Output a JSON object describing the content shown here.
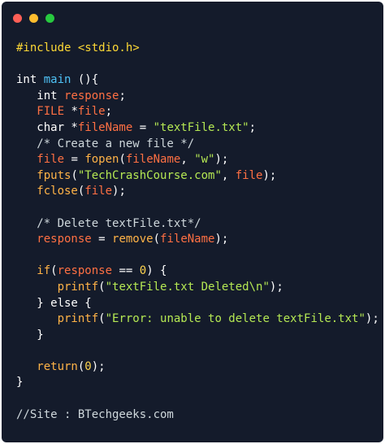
{
  "window": {
    "controls": [
      {
        "name": "close",
        "color": "#ff5f56"
      },
      {
        "name": "minimize",
        "color": "#ffbd2e"
      },
      {
        "name": "maximize",
        "color": "#27c93f"
      }
    ]
  },
  "colors": {
    "background": "#141b2b",
    "plain": "#ffffff",
    "preprocessor": "#fdd835",
    "keyword": "#ffffff",
    "variable": "#ff7043",
    "string": "#b5e853",
    "comment": "#cfd8dc",
    "function": "#ffb347",
    "number": "#ffd54f",
    "identifier": "#4fc3f7"
  },
  "code_lines": [
    [
      {
        "t": "#include <stdio.h>",
        "c": "preprocessor"
      }
    ],
    [],
    [
      {
        "t": "int ",
        "c": "keyword"
      },
      {
        "t": "main",
        "c": "identifier"
      },
      {
        "t": " (){",
        "c": "plain"
      }
    ],
    [
      {
        "t": "   int ",
        "c": "keyword"
      },
      {
        "t": "response",
        "c": "variable"
      },
      {
        "t": ";",
        "c": "plain"
      }
    ],
    [
      {
        "t": "   FILE ",
        "c": "variable"
      },
      {
        "t": "*",
        "c": "plain"
      },
      {
        "t": "file",
        "c": "variable"
      },
      {
        "t": ";",
        "c": "plain"
      }
    ],
    [
      {
        "t": "   char *",
        "c": "keyword"
      },
      {
        "t": "fileName",
        "c": "variable"
      },
      {
        "t": " = ",
        "c": "plain"
      },
      {
        "t": "\"textFile.txt\"",
        "c": "string"
      },
      {
        "t": ";",
        "c": "plain"
      }
    ],
    [
      {
        "t": "   /* Create a new file */",
        "c": "comment"
      }
    ],
    [
      {
        "t": "   file",
        "c": "variable"
      },
      {
        "t": " = ",
        "c": "plain"
      },
      {
        "t": "fopen",
        "c": "function"
      },
      {
        "t": "(",
        "c": "plain"
      },
      {
        "t": "fileName",
        "c": "variable"
      },
      {
        "t": ", ",
        "c": "plain"
      },
      {
        "t": "\"w\"",
        "c": "string"
      },
      {
        "t": ");",
        "c": "plain"
      }
    ],
    [
      {
        "t": "   fputs",
        "c": "function"
      },
      {
        "t": "(",
        "c": "plain"
      },
      {
        "t": "\"TechCrashCourse.com\"",
        "c": "string"
      },
      {
        "t": ", ",
        "c": "plain"
      },
      {
        "t": "file",
        "c": "variable"
      },
      {
        "t": ");",
        "c": "plain"
      }
    ],
    [
      {
        "t": "   fclose",
        "c": "function"
      },
      {
        "t": "(",
        "c": "plain"
      },
      {
        "t": "file",
        "c": "variable"
      },
      {
        "t": ");",
        "c": "plain"
      }
    ],
    [],
    [
      {
        "t": "   /* Delete textFile.txt*/",
        "c": "comment"
      }
    ],
    [
      {
        "t": "   response",
        "c": "variable"
      },
      {
        "t": " = ",
        "c": "plain"
      },
      {
        "t": "remove",
        "c": "function"
      },
      {
        "t": "(",
        "c": "plain"
      },
      {
        "t": "fileName",
        "c": "variable"
      },
      {
        "t": ");",
        "c": "plain"
      }
    ],
    [],
    [
      {
        "t": "   if",
        "c": "function"
      },
      {
        "t": "(",
        "c": "plain"
      },
      {
        "t": "response",
        "c": "variable"
      },
      {
        "t": " == ",
        "c": "plain"
      },
      {
        "t": "0",
        "c": "number"
      },
      {
        "t": ") {",
        "c": "plain"
      }
    ],
    [
      {
        "t": "      printf",
        "c": "function"
      },
      {
        "t": "(",
        "c": "plain"
      },
      {
        "t": "\"textFile.txt Deleted\\n\"",
        "c": "string"
      },
      {
        "t": ");",
        "c": "plain"
      }
    ],
    [
      {
        "t": "   } else {",
        "c": "plain"
      }
    ],
    [
      {
        "t": "      printf",
        "c": "function"
      },
      {
        "t": "(",
        "c": "plain"
      },
      {
        "t": "\"Error: unable to delete textFile.txt\"",
        "c": "string"
      },
      {
        "t": ");",
        "c": "plain"
      }
    ],
    [
      {
        "t": "   }",
        "c": "plain"
      }
    ],
    [],
    [
      {
        "t": "   return",
        "c": "function"
      },
      {
        "t": "(",
        "c": "plain"
      },
      {
        "t": "0",
        "c": "number"
      },
      {
        "t": ");",
        "c": "plain"
      }
    ],
    [
      {
        "t": "}",
        "c": "plain"
      }
    ],
    [],
    [
      {
        "t": "//Site : BTechgeeks.com",
        "c": "comment"
      }
    ]
  ]
}
